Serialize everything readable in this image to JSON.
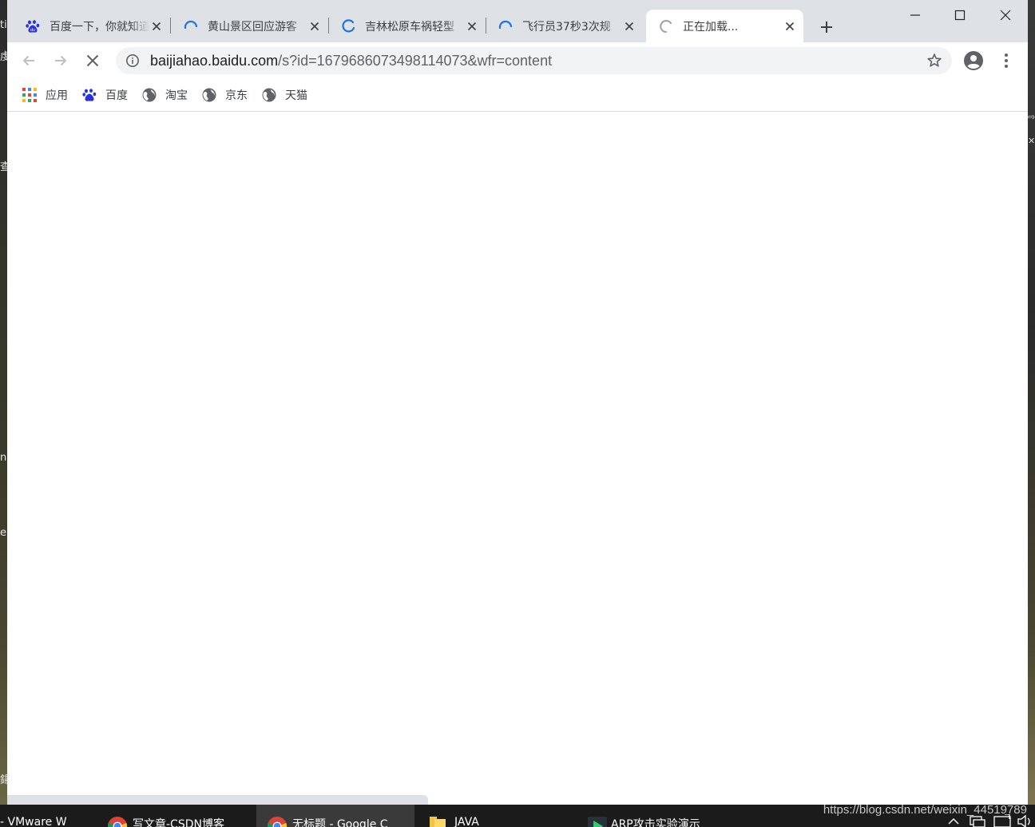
{
  "desktop": {
    "left_fragments": [
      "ti",
      "虔",
      "查",
      "ng",
      "e",
      "鍚"
    ],
    "right_fragments": [
      "⇨",
      "✕"
    ]
  },
  "tabs": [
    {
      "title": "百度一下，你就知道",
      "favicon": "baidu-paw-icon",
      "state": "loaded"
    },
    {
      "title": "黄山景区回应游客",
      "favicon": "loading-spinner-icon",
      "state": "loading"
    },
    {
      "title": "吉林松原车祸轻型",
      "favicon": "loading-spinner-icon",
      "state": "loading"
    },
    {
      "title": "飞行员37秒3次规",
      "favicon": "loading-spinner-icon",
      "state": "loading"
    },
    {
      "title": "正在加载...",
      "favicon": "loading-spinner-gray-icon",
      "state": "active-loading"
    }
  ],
  "window_controls": {
    "minimize": "minimize-icon",
    "maximize": "maximize-icon",
    "close": "close-icon"
  },
  "address_bar": {
    "host": "baijiahao.baidu.com",
    "path": "/s?id=1679686073498114073&wfr=content"
  },
  "bookmarks": [
    {
      "label": "应用",
      "icon": "apps-grid-icon"
    },
    {
      "label": "百度",
      "icon": "baidu-paw-icon"
    },
    {
      "label": "淘宝",
      "icon": "globe-icon"
    },
    {
      "label": "京东",
      "icon": "globe-icon"
    },
    {
      "label": "天猫",
      "icon": "globe-icon"
    }
  ],
  "taskbar": {
    "items": [
      {
        "label": "- VMware W",
        "icon": ""
      },
      {
        "label": "写文章-CSDN博客",
        "icon": "chrome-icon"
      },
      {
        "label": "无标题 - Google C",
        "icon": "chrome-icon"
      },
      {
        "label": "JAVA",
        "icon": "folder-icon"
      },
      {
        "label": "ARP攻击实验演示",
        "icon": "media-player-icon"
      }
    ],
    "watermark": "https://blog.csdn.net/weixin_44519789"
  },
  "colors": {
    "tabstrip": "#dee1e6",
    "accent_spinner": "#1a73e8",
    "omnibox": "#f1f3f4"
  }
}
